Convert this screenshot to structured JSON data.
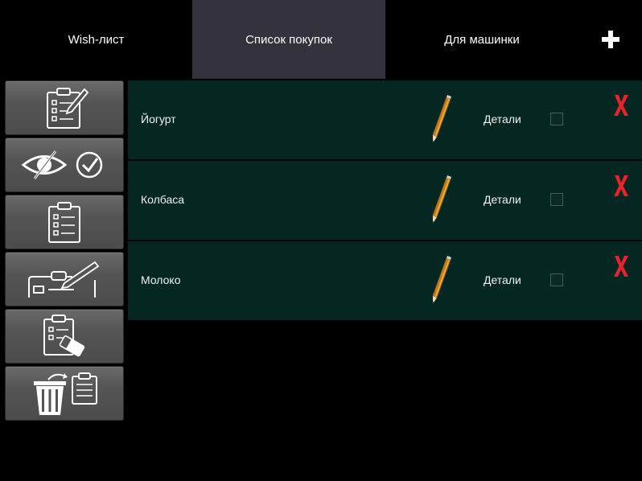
{
  "tabs": [
    {
      "label": "Wish-лист",
      "active": false
    },
    {
      "label": "Список покупок",
      "active": true
    },
    {
      "label": "Для машинки",
      "active": false
    }
  ],
  "add_tab_icon": "plus-icon",
  "toolbar": {
    "tools": [
      {
        "icon": "edit-list-icon"
      },
      {
        "icon": "hide-checked-icon"
      },
      {
        "icon": "checklist-icon"
      },
      {
        "icon": "edit-item-icon"
      },
      {
        "icon": "clear-list-icon"
      },
      {
        "icon": "delete-list-icon"
      }
    ]
  },
  "items": [
    {
      "name": "Йогурт",
      "details_label": "Детали",
      "checked": false
    },
    {
      "name": "Колбаса",
      "details_label": "Детали",
      "checked": false
    },
    {
      "name": "Молоко",
      "details_label": "Детали",
      "checked": false
    }
  ],
  "colors": {
    "active_tab": "#34333d",
    "row_background": "#042722",
    "delete_red": "#e8232b",
    "toolbar_button": "#555555"
  }
}
